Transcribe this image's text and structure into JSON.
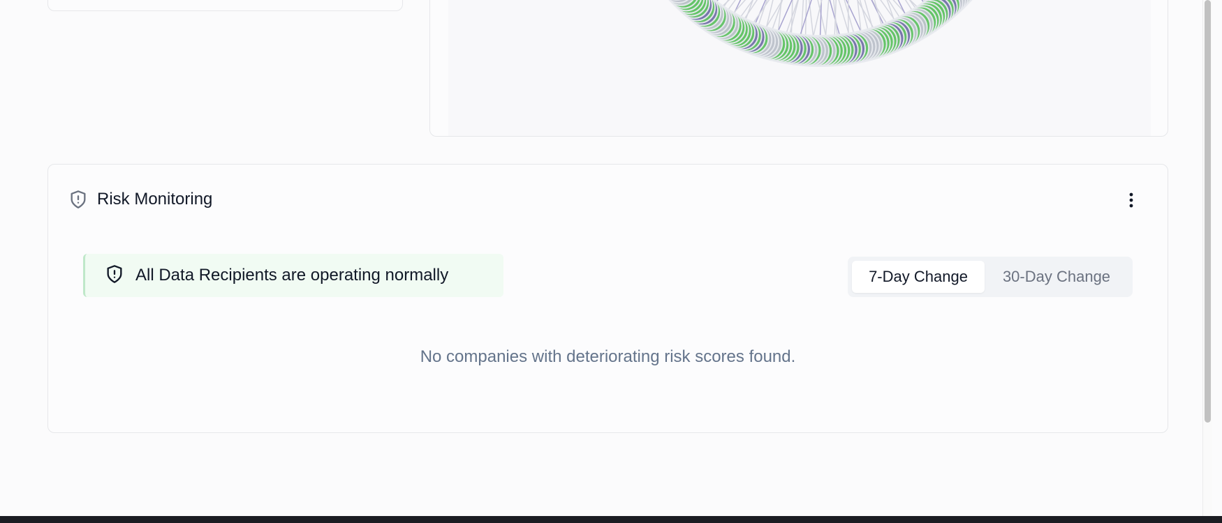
{
  "risk_monitoring": {
    "title": "Risk Monitoring",
    "status_message": "All Data Recipients are operating normally",
    "toggle": {
      "options": [
        "7-Day Change",
        "30-Day Change"
      ],
      "selected": "7-Day Change"
    },
    "empty_message": "No companies with deteriorating risk scores found."
  },
  "icons": {
    "title_icon": "shield-alert-icon",
    "status_icon": "shield-alert-icon",
    "menu_icon": "more-vertical-icon"
  },
  "colors": {
    "node_green": "#63c566",
    "node_purple": "#7a72b0",
    "node_gray": "#bfc3cd",
    "status_bg": "#f1fbf3",
    "muted_text": "#64748b"
  }
}
